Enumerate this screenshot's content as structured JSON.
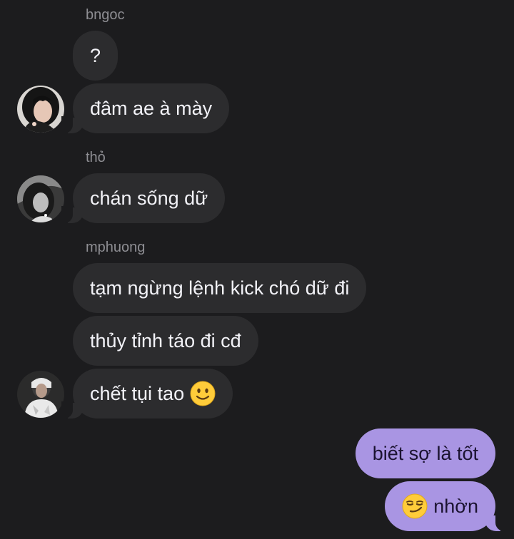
{
  "conversation": {
    "groups": [
      {
        "sender": "bngoc",
        "messages": [
          "?",
          "đâm ae à mày"
        ]
      },
      {
        "sender": "thỏ",
        "messages": [
          "chán sống dữ"
        ]
      },
      {
        "sender": "mphuong",
        "messages": [
          "tạm ngừng lệnh kick chó dữ đi",
          "thủy tỉnh táo đi cđ",
          "chết tụi tao"
        ]
      }
    ],
    "outgoing": [
      "biết sợ là tốt",
      "nhờn"
    ],
    "icons": {
      "slight_smile": "slightly-smiling-face-icon",
      "smirk": "smirking-face-icon"
    }
  },
  "colors": {
    "background": "#1c1c1e",
    "incoming_bubble": "#2c2c2e",
    "outgoing_bubble": "#a995e3",
    "sender_name": "#8e8e93"
  }
}
